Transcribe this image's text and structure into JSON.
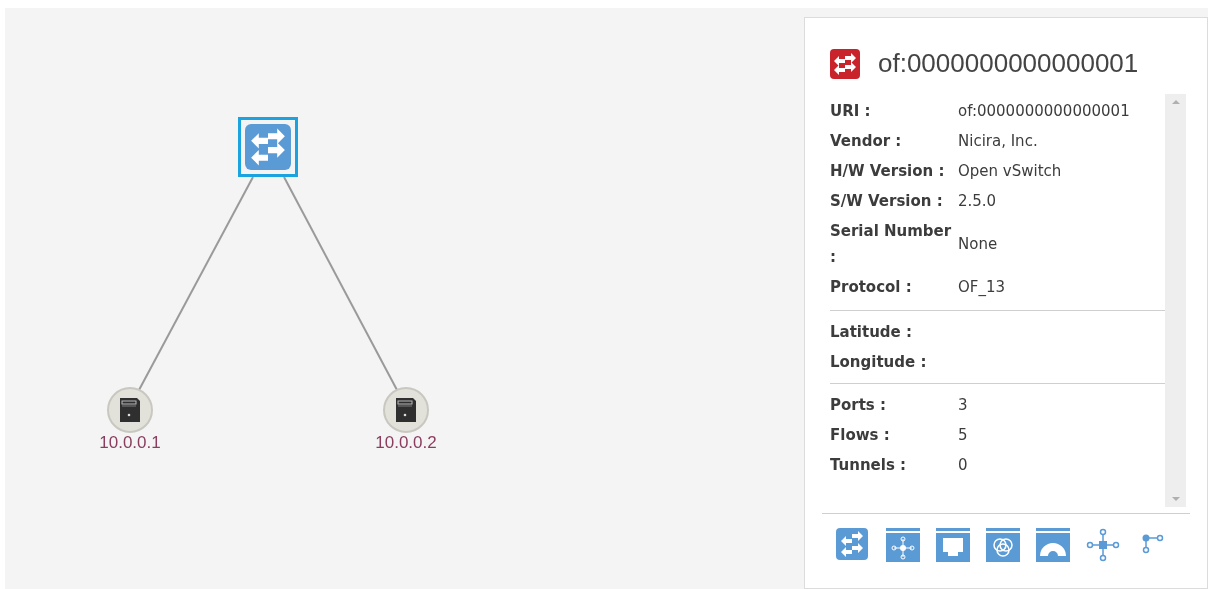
{
  "topology": {
    "switch": {
      "selected": true
    },
    "hosts": [
      {
        "label": "10.0.0.1"
      },
      {
        "label": "10.0.0.2"
      }
    ]
  },
  "details": {
    "title": "of:0000000000000001",
    "sections": [
      [
        {
          "label": "URI :",
          "value": "of:0000000000000001"
        },
        {
          "label": "Vendor :",
          "value": "Nicira, Inc."
        },
        {
          "label": "H/W Version :",
          "value": "Open vSwitch"
        },
        {
          "label": "S/W Version :",
          "value": "2.5.0"
        },
        {
          "label": "Serial Number :",
          "value": "None"
        },
        {
          "label": "Protocol :",
          "value": "OF_13"
        }
      ],
      [
        {
          "label": "Latitude :"
        },
        {
          "label": "Longitude :"
        }
      ],
      [
        {
          "label": "Ports :",
          "value": "3"
        },
        {
          "label": "Flows :",
          "value": "5"
        },
        {
          "label": "Tunnels :",
          "value": "0"
        }
      ]
    ],
    "actions": [
      {
        "kind": "switch"
      },
      {
        "kind": "ports"
      },
      {
        "kind": "ethernet"
      },
      {
        "kind": "groups"
      },
      {
        "kind": "meters"
      },
      {
        "kind": "pipeline"
      },
      {
        "kind": "branch"
      }
    ]
  }
}
